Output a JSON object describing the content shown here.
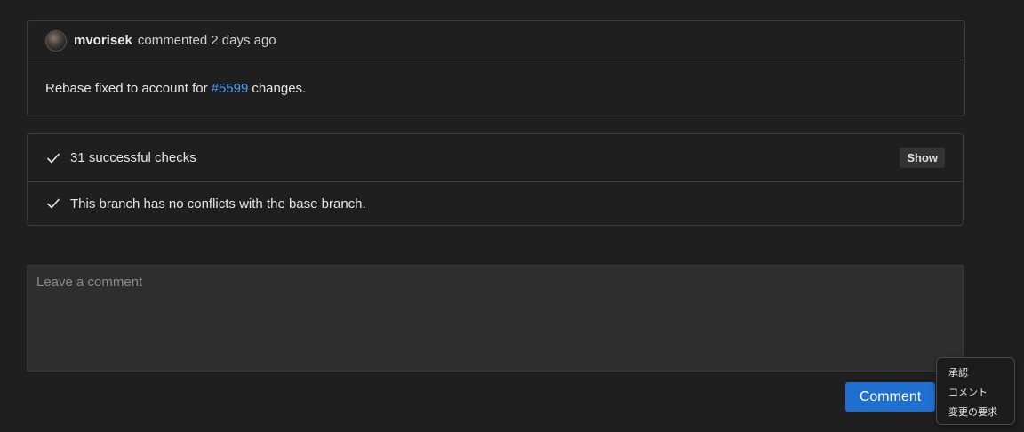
{
  "comment": {
    "author": "mvorisek",
    "action": "commented",
    "time": "2 days ago",
    "body_before": "Rebase fixed to account for",
    "link_text": "#5599",
    "body_after": "changes."
  },
  "checks": {
    "summary": "31 successful checks",
    "show_label": "Show",
    "conflicts": "This branch has no conflicts with the base branch."
  },
  "comment_box": {
    "placeholder": "Leave a comment",
    "value": ""
  },
  "comment_button": {
    "label": "Comment",
    "color": "#1f6fd1"
  },
  "review_menu": {
    "items": [
      "承認",
      "コメント",
      "変更の要求"
    ]
  },
  "colors": {
    "background": "#1f1f1f",
    "link": "#4c9bf5",
    "border": "#3d3d3d"
  }
}
